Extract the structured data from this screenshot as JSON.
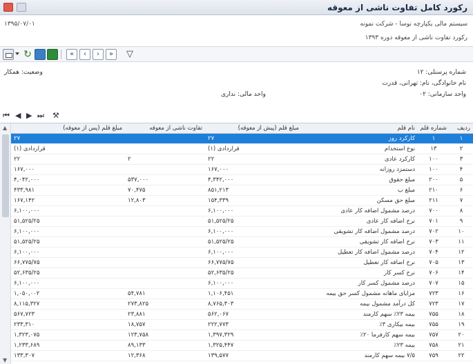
{
  "window": {
    "title": "رکورد کامل تفاوت ناشی از معوقه"
  },
  "header": {
    "doc_no": "۱۳۹۵/۰۷/۰۱",
    "system": "سیستم مالی یکپارچه نوسا - شرکت نمونه",
    "report": "رکورد تفاوت ناشی از معوقه دوره ۱۳۹۳"
  },
  "info": {
    "personnel_no": "شماره پرسنلی: ۱۲",
    "name": "نام خانوادگی، نام: تهرانی، قدرت",
    "org_unit": "واحد سازمانی: ۰۲",
    "financial_unit": "واحد مالی: نداری",
    "status": "وضعیت: همکار"
  },
  "grid": {
    "columns": [
      "ردیف",
      "شماره قلم",
      "نام قلم",
      "مبلغ قلم (پیش از معوقه)",
      "تفاوت ناشی از معوقه",
      "مبلغ قلم (پس از معوقه)"
    ],
    "rows": [
      {
        "r": "۱",
        "code": "۱",
        "name": "کارکرد روز",
        "before": "۲۷",
        "diff": "",
        "after": "۲۷",
        "selected": true
      },
      {
        "r": "۲",
        "code": "۱۳",
        "name": "نوع استخدام",
        "before": "(۱) قراردادی",
        "diff": "",
        "after": "(۱) قراردادی"
      },
      {
        "r": "۳",
        "code": "۱۰۰",
        "name": "کارکرد عادی",
        "before": "۲۲",
        "diff": "۲",
        "after": "۲۲"
      },
      {
        "r": "۴",
        "code": "۱۰۰",
        "name": "دستمزد روزانه",
        "before": "۱۶۷,۰۰۰",
        "diff": "",
        "after": "۱۶۷,۰۰۰"
      },
      {
        "r": "۵",
        "code": "۲۰۰",
        "name": "مبلغ حقوق",
        "before": "۴,۳۴۲,۰۰۰",
        "diff": "۵۳۷,۰۰۰",
        "after": "۴,۰۴۲,۰۰۰"
      },
      {
        "r": "۶",
        "code": "۲۱۰",
        "name": "مبلغ ب",
        "before": "۸۵۱,۲۱۳",
        "diff": "۷۰,۴۷۵",
        "after": "۴۳۳,۹۸۱"
      },
      {
        "r": "۷",
        "code": "۲۱۱",
        "name": "مبلغ حق مسکن",
        "before": "۱۵۴,۳۳۹",
        "diff": "۱۲,۸۰۳",
        "after": "۱۶۷,۱۴۲"
      },
      {
        "r": "۸",
        "code": "۷۰۰",
        "name": "درصد مشمول اضافه کار عادی",
        "before": "۶,۱۰۰,۰۰۰",
        "diff": "",
        "after": "۶,۱۰۰,۰۰۰"
      },
      {
        "r": "۹",
        "code": "۷۰۱",
        "name": "نرخ اضافه کار عادی",
        "before": "۵۱,۵۲۵/۲۵",
        "diff": "",
        "after": "۵۱,۵۲۵/۲۵"
      },
      {
        "r": "۱۰",
        "code": "۷۰۲",
        "name": "درصد مشمول اضافه کار تشویقی",
        "before": "۶,۱۰۰,۰۰۰",
        "diff": "",
        "after": "۶,۱۰۰,۰۰۰"
      },
      {
        "r": "۱۱",
        "code": "۷۰۳",
        "name": "نرخ اضافه کار تشویقی",
        "before": "۵۱,۵۲۵/۲۵",
        "diff": "",
        "after": "۵۱,۵۲۵/۲۵"
      },
      {
        "r": "۱۲",
        "code": "۷۰۴",
        "name": "درصد مشمول اضافه کار تعطیل",
        "before": "۶,۱۰۰,۰۰۰",
        "diff": "",
        "after": "۶,۱۰۰,۰۰۰"
      },
      {
        "r": "۱۳",
        "code": "۷۰۵",
        "name": "نرخ اضافه کار تعطیل",
        "before": "۶۶,۷۷۵/۷۵",
        "diff": "",
        "after": "۶۶,۷۷۵/۷۵"
      },
      {
        "r": "۱۴",
        "code": "۷۰۶",
        "name": "نرخ کسر کار",
        "before": "۵۲,۶۳۵/۲۵",
        "diff": "",
        "after": "۵۲,۶۳۵/۲۵"
      },
      {
        "r": "۱۵",
        "code": "۷۰۷",
        "name": "درصد مشمول کسر کار",
        "before": "۶,۱۰۰,۰۰۰",
        "diff": "",
        "after": "۶,۱۰۰,۰۰۰"
      },
      {
        "r": "۱۶",
        "code": "۷۲۳",
        "name": "مزایای ماهانه مشمول کسر حق بیمه",
        "before": "۱,۱۰۶,۴۵۱",
        "diff": "۵۴,۷۸۱",
        "after": "۱,۰۵۰,۰۰۲"
      },
      {
        "r": "۱۷",
        "code": "۷۲۳",
        "name": "کل درآمد مشمول بیمه",
        "before": "۸,۷۶۵,۳۰۳",
        "diff": "۲۷۳,۸۲۵",
        "after": "۸,۱۱۵,۳۲۷"
      },
      {
        "r": "۱۸",
        "code": "۷۵۵",
        "name": "بیمه ۲۳٪ سهم کارمند",
        "before": "۵۶۲,۰۶۷",
        "diff": "۲۳,۸۸۱",
        "after": "۵۶۷,۷۲۳"
      },
      {
        "r": "۱۹",
        "code": "۷۵۵",
        "name": "بیمه بیکاری ۳٪",
        "before": "۲۲۲,۷۷۳",
        "diff": "۱۸,۷۵۷",
        "after": "۲۳۳,۳۱۰"
      },
      {
        "r": "۲۰",
        "code": "۷۵۷",
        "name": "بیمه سهم کارفرما ۲۰٪",
        "before": "۱,۳۹۷,۳۲۹",
        "diff": "۱۲۳,۷۵۸",
        "after": "۱,۳۲۳,۰۷۵"
      },
      {
        "r": "۲۱",
        "code": "۷۵۸",
        "name": "بیمه ۲۳٪",
        "before": "۱,۳۲۵,۴۴۷",
        "diff": "۸۹,۱۳۳",
        "after": "۱,۲۳۳,۶۸۹"
      },
      {
        "r": "۲۲",
        "code": "۷۵۹",
        "name": "۷/۵ بیمه سهم کارمند",
        "before": "۱۳۹,۵۷۷",
        "diff": "۱۲,۳۶۸",
        "after": "۱۳۳,۳۰۷"
      }
    ]
  }
}
